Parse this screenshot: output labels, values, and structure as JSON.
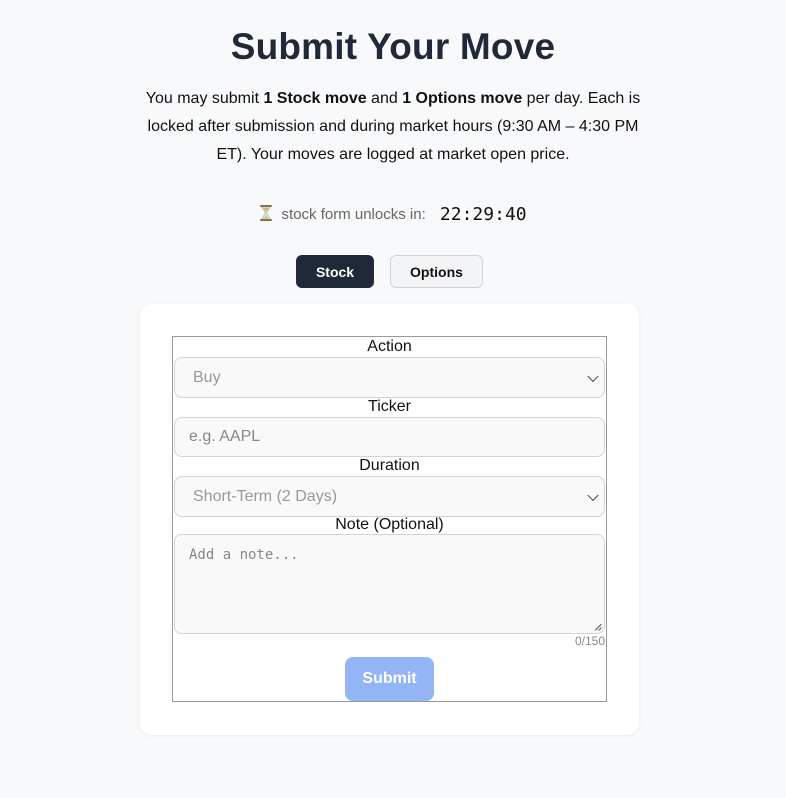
{
  "page": {
    "title": "Submit Your Move",
    "intro": {
      "part1": "You may submit ",
      "stock_move": "1 Stock move",
      "part2": " and ",
      "options_move": "1 Options move",
      "part3": " per day. Each is locked after submission and during market hours (9:30 AM – 4:30 PM ET). Your moves are logged at market open price."
    }
  },
  "countdown": {
    "icon": "hourglass-icon",
    "label": "stock form unlocks in:",
    "time": "22:29:40"
  },
  "tabs": [
    {
      "label": "Stock",
      "active": true
    },
    {
      "label": "Options",
      "active": false
    }
  ],
  "form": {
    "action": {
      "label": "Action",
      "value": "Buy"
    },
    "ticker": {
      "label": "Ticker",
      "placeholder": "e.g. AAPL"
    },
    "duration": {
      "label": "Duration",
      "value": "Short-Term (2 Days)"
    },
    "note": {
      "label": "Note (Optional)",
      "placeholder": "Add a note...",
      "counter": "0/150"
    },
    "submit_label": "Submit"
  },
  "colors": {
    "background": "#f8f9fb",
    "active_tab": "#1f2937",
    "submit_disabled": "#93b4f5"
  }
}
